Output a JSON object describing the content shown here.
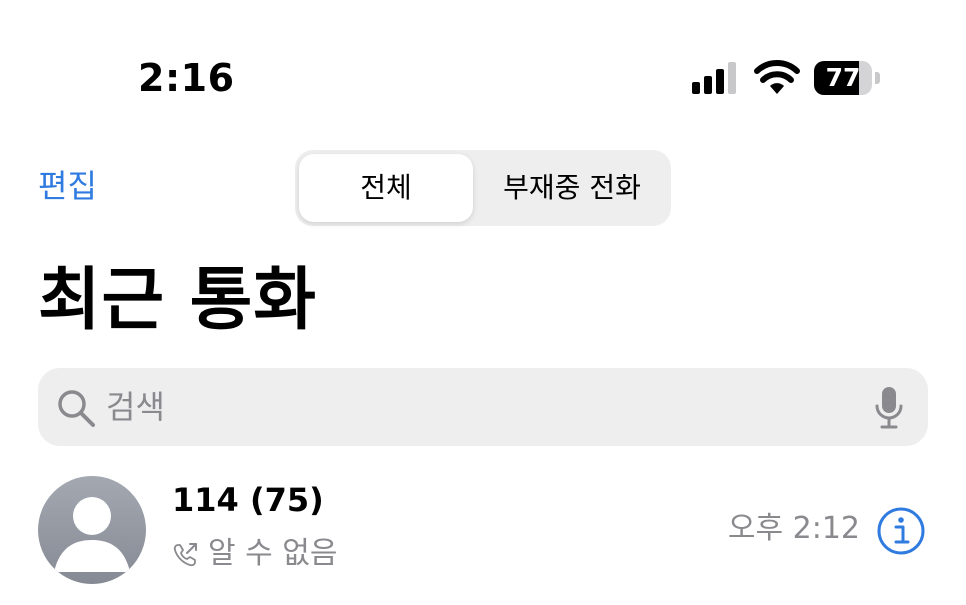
{
  "status_bar": {
    "time": "2:16",
    "battery_percent": "77",
    "battery_level": 0.77,
    "signal_bars": 3
  },
  "nav": {
    "edit_label": "편집",
    "segments": [
      {
        "label": "전체",
        "selected": true
      },
      {
        "label": "부재중 전화",
        "selected": false
      }
    ]
  },
  "title": "최근 통화",
  "search": {
    "placeholder": "검색"
  },
  "calls": [
    {
      "name": "114 (75)",
      "type": "알 수 없음",
      "time": "오후 2:12"
    }
  ],
  "colors": {
    "accent": "#2f7be0",
    "secondary_text": "#8a8a8e",
    "search_background": "#eeeeef"
  },
  "icons": {
    "search": "magnifying-glass",
    "mic": "microphone",
    "call_type": "outgoing-call",
    "info": "info-circle",
    "avatar": "person-silhouette"
  }
}
